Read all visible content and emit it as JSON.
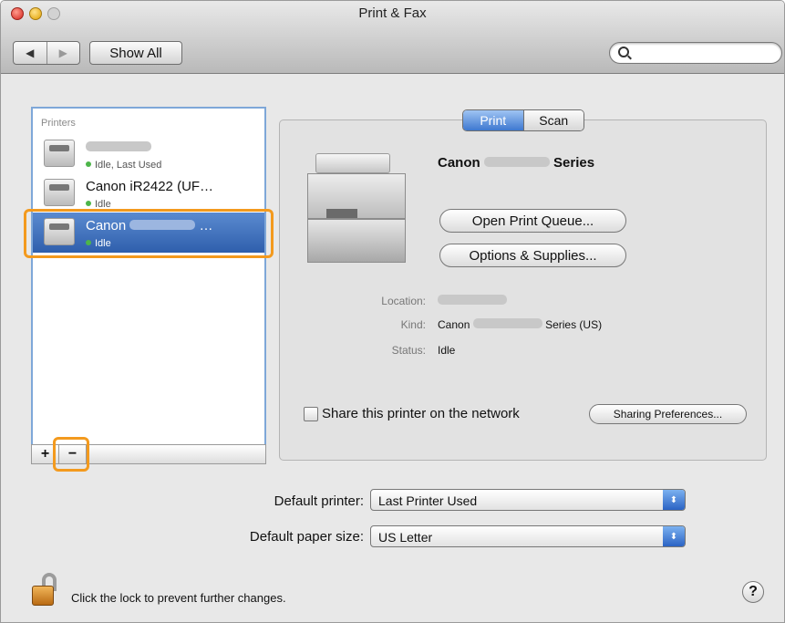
{
  "window": {
    "title": "Print & Fax",
    "nav_back": "◀",
    "nav_forward": "▶",
    "show_all": "Show All",
    "search": {
      "value": "",
      "placeholder": ""
    }
  },
  "printers_list": {
    "header": "Printers",
    "items": [
      {
        "name": "",
        "status": "Idle, Last Used",
        "selected": false
      },
      {
        "name": "Canon iR2422 (UF…",
        "status": "Idle",
        "selected": false
      },
      {
        "name": "Canon",
        "name_suffix": "…",
        "status": "Idle",
        "selected": true
      }
    ],
    "add_label": "+",
    "remove_label": "−"
  },
  "tabs": [
    {
      "label": "Print",
      "active": true
    },
    {
      "label": "Scan",
      "active": false
    }
  ],
  "detail": {
    "model_prefix": "Canon",
    "model_suffix": "Series",
    "open_queue": "Open Print Queue...",
    "options_supplies": "Options & Supplies...",
    "location_label": "Location:",
    "kind_label": "Kind:",
    "kind_prefix": "Canon",
    "kind_suffix": "Series (US)",
    "status_label": "Status:",
    "status_value": "Idle",
    "share_label": "Share this printer on the network",
    "sharing_prefs": "Sharing Preferences..."
  },
  "defaults": {
    "printer_label": "Default printer:",
    "printer_value": "Last Printer Used",
    "paper_label": "Default paper size:",
    "paper_value": "US Letter",
    "select_arrow": "⬍"
  },
  "footer": {
    "lock_text": "Click the lock to prevent further changes.",
    "help": "?"
  },
  "colors": {
    "accent": "#3e78d0",
    "highlight": "#f39a1e",
    "idle_dot": "#4db54a"
  }
}
